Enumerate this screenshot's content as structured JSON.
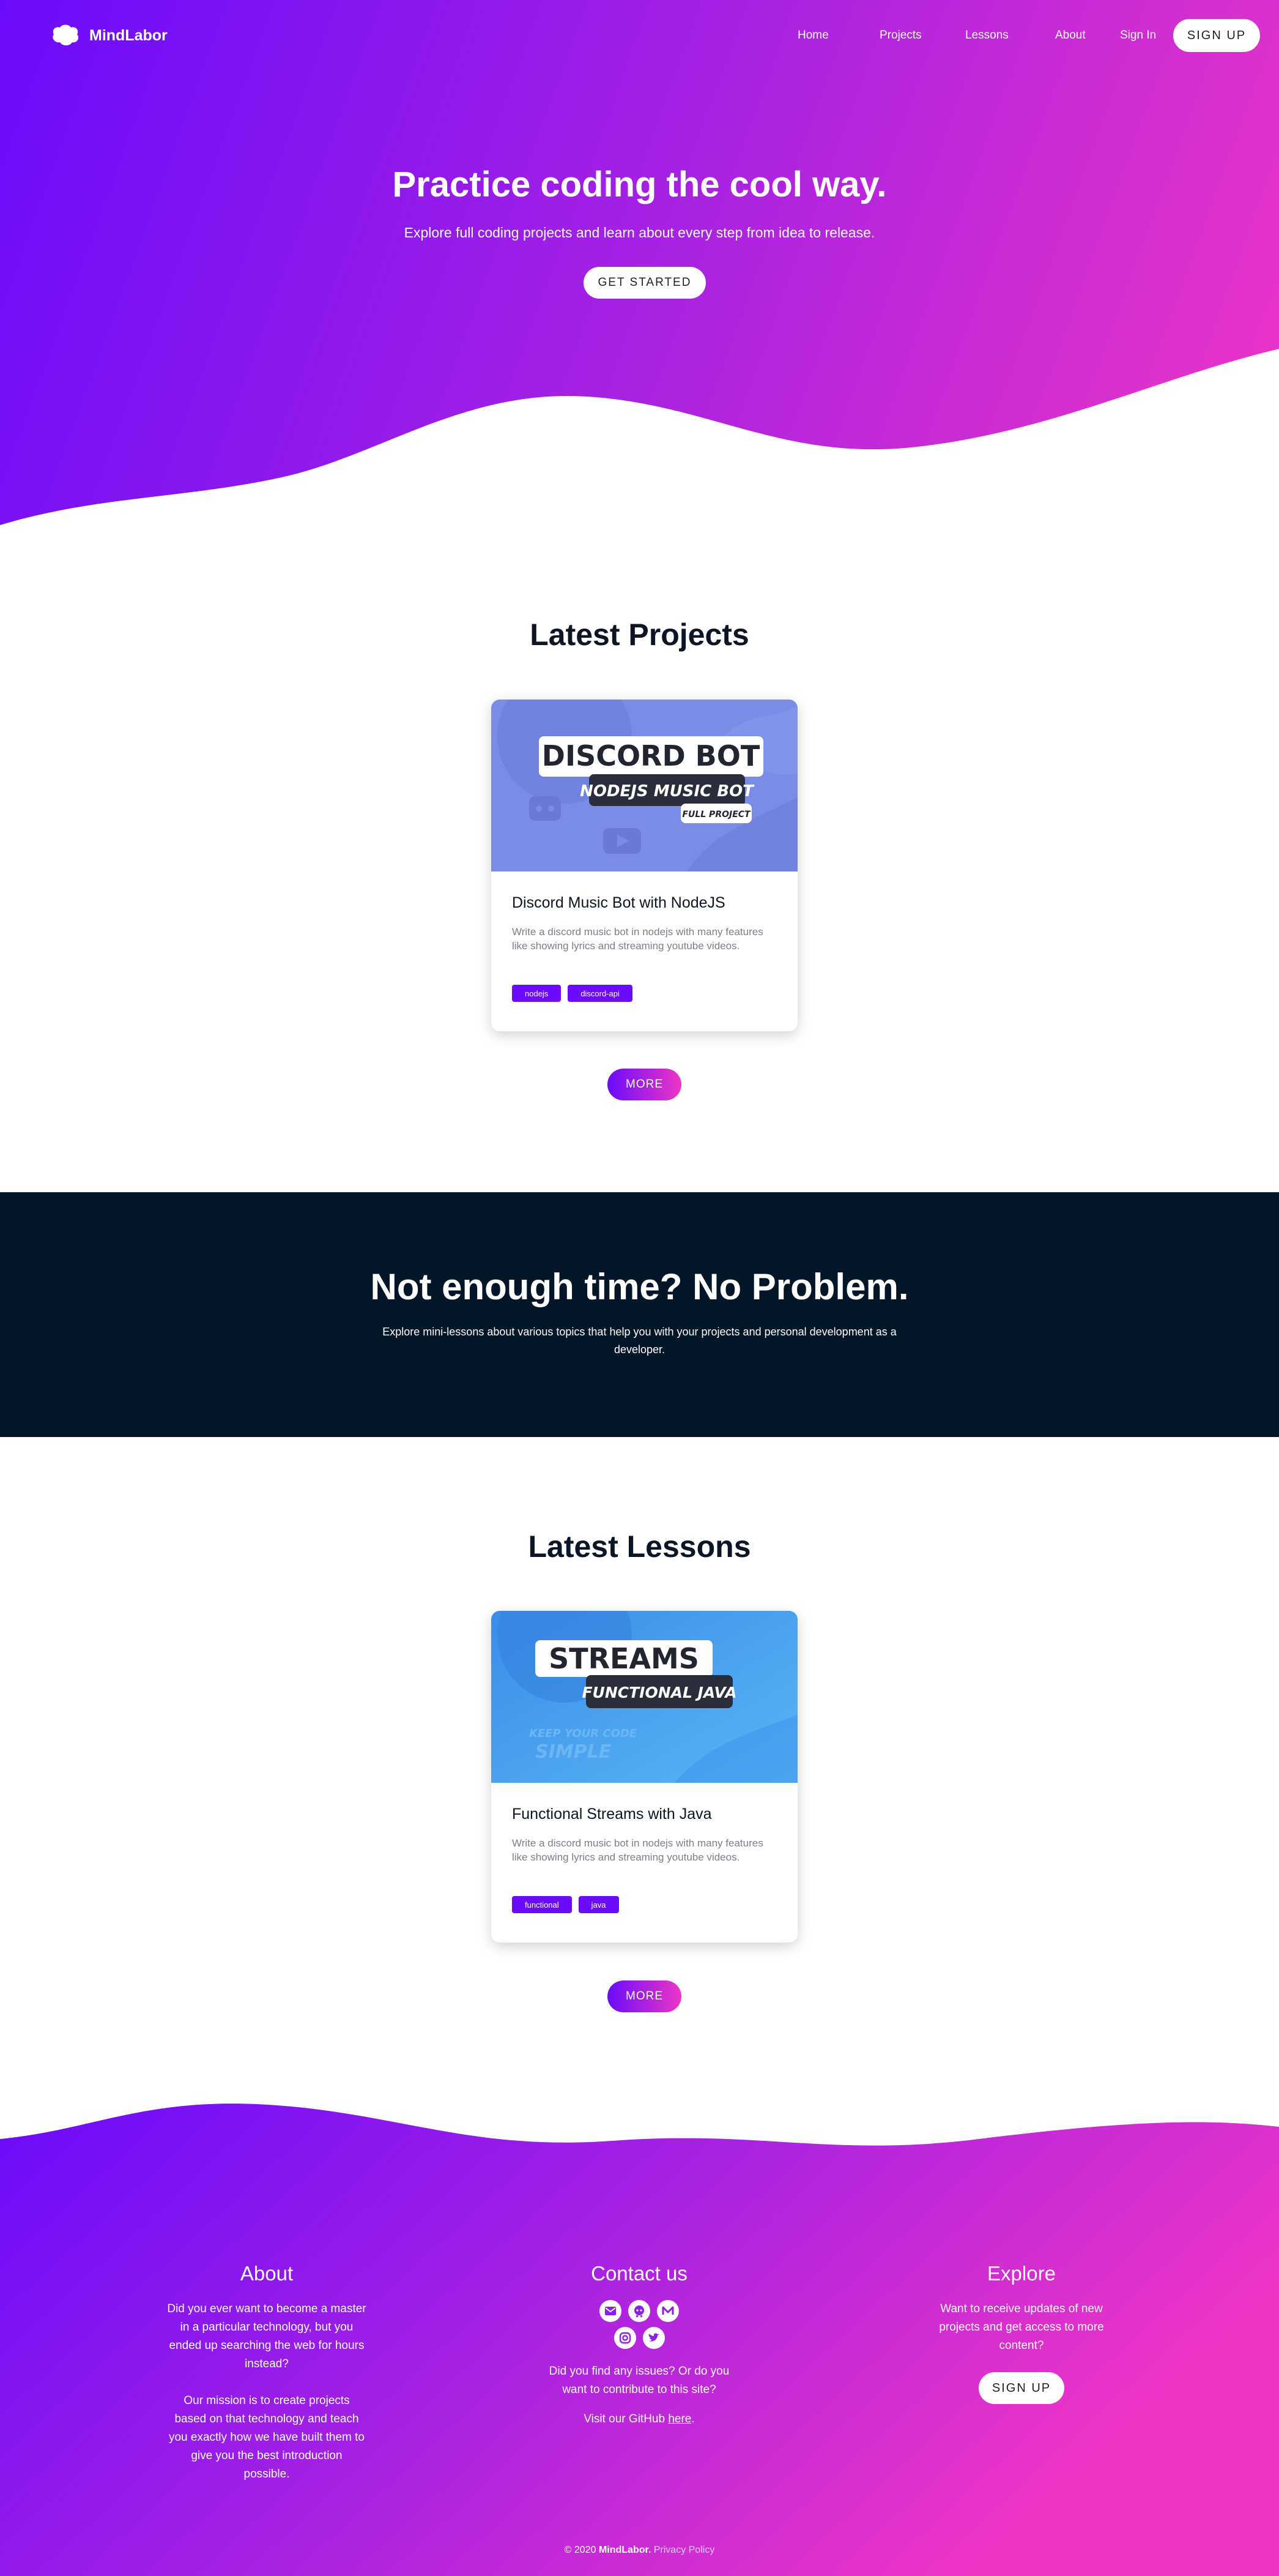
{
  "colors": {
    "gradient_start": "#6a0bfb",
    "gradient_mid": "#a521e3",
    "gradient_end": "#ef35c6",
    "dark_band": "#031627",
    "tag": "#6a0bfb"
  },
  "nav": {
    "brand": "MindLabor",
    "links": [
      "Home",
      "Projects",
      "Lessons",
      "About"
    ],
    "sign_in": "Sign In",
    "sign_up": "SIGN UP"
  },
  "hero": {
    "title": "Practice coding the cool way.",
    "subtitle": "Explore full coding projects and learn about every step from idea to release.",
    "cta": "GET STARTED"
  },
  "projects": {
    "title": "Latest Projects",
    "card": {
      "thumb": {
        "line1": "DISCORD BOT",
        "line2": "NODEJS MUSIC BOT",
        "line3": "FULL PROJECT"
      },
      "title": "Discord Music Bot with NodeJS",
      "description": "Write a discord music bot in nodejs with many features like showing lyrics and streaming youtube videos.",
      "tags": [
        "nodejs",
        "discord-api"
      ]
    },
    "more": "MORE"
  },
  "promo": {
    "title": "Not enough time? No Problem.",
    "subtitle": "Explore mini-lessons about various topics that help you with your projects and personal development as a developer."
  },
  "lessons": {
    "title": "Latest Lessons",
    "card": {
      "thumb": {
        "line1": "STREAMS",
        "line2": "FUNCTIONAL JAVA",
        "line3": "KEEP YOUR CODE",
        "line4": "SIMPLE"
      },
      "title": "Functional Streams with Java",
      "description": "Write a discord music bot in nodejs with many features like showing lyrics and streaming youtube videos.",
      "tags": [
        "functional",
        "java"
      ]
    },
    "more": "MORE"
  },
  "footer": {
    "about": {
      "title": "About",
      "p1": "Did you ever want to become a master in a particular technology, but you ended up searching the web for hours instead?",
      "p2": "Our mission is to create projects based on that technology and teach you exactly how we have built them to give you the best introduction possible."
    },
    "contact": {
      "title": "Contact us",
      "icons": [
        "mail-icon",
        "github-icon",
        "medium-icon",
        "instagram-icon",
        "twitter-icon"
      ],
      "issues": "Did you find any issues? Or do you want to contribute to this site?",
      "github_prefix": "Visit our GitHub ",
      "github_link": "here",
      "github_suffix": "."
    },
    "explore": {
      "title": "Explore",
      "text": "Want to receive updates of new projects and get access to more content?",
      "button": "SIGN UP"
    },
    "copyright_prefix": "© 2020 ",
    "copyright_brand": "MindLabor.",
    "privacy": "Privacy Policy"
  }
}
